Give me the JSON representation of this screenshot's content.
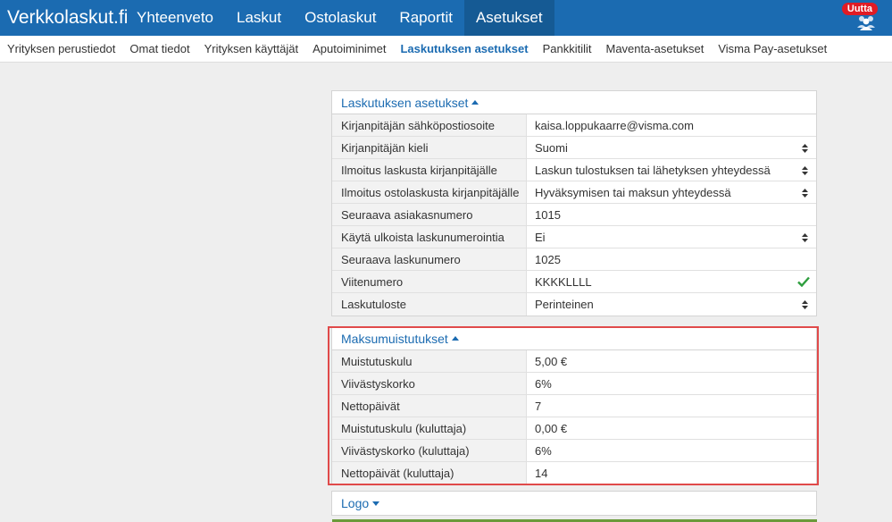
{
  "app": {
    "brand": "Verkkolaskut.fi",
    "nav": [
      "Yhteenveto",
      "Laskut",
      "Ostolaskut",
      "Raportit",
      "Asetukset"
    ],
    "nav_active_index": 4,
    "new_badge": "Uutta",
    "icon": "users-icon"
  },
  "subnav": {
    "items": [
      "Yrityksen perustiedot",
      "Omat tiedot",
      "Yrityksen käyttäjät",
      "Aputoiminimet",
      "Laskutuksen asetukset",
      "Pankkitilit",
      "Maventa-asetukset",
      "Visma Pay-asetukset"
    ],
    "active_index": 4
  },
  "billing": {
    "title": "Laskutuksen asetukset",
    "rows": [
      {
        "label": "Kirjanpitäjän sähköpostiosoite",
        "value": "kaisa.loppukaarre@visma.com",
        "control": "text"
      },
      {
        "label": "Kirjanpitäjän kieli",
        "value": "Suomi",
        "control": "select"
      },
      {
        "label": "Ilmoitus laskusta kirjanpitäjälle",
        "value": "Laskun tulostuksen tai lähetyksen yhteydessä",
        "control": "select"
      },
      {
        "label": "Ilmoitus ostolaskusta kirjanpitäjälle",
        "value": "Hyväksymisen tai maksun yhteydessä",
        "control": "select"
      },
      {
        "label": "Seuraava asiakasnumero",
        "value": "1015",
        "control": "text"
      },
      {
        "label": "Käytä ulkoista laskunumerointia",
        "value": "Ei",
        "control": "select"
      },
      {
        "label": "Seuraava laskunumero",
        "value": "1025",
        "control": "text"
      },
      {
        "label": "Viitenumero",
        "value": "KKKKLLLL",
        "control": "valid"
      },
      {
        "label": "Laskutuloste",
        "value": "Perinteinen",
        "control": "select"
      }
    ]
  },
  "reminders": {
    "title": "Maksumuistutukset",
    "rows": [
      {
        "label": "Muistutuskulu",
        "value": "5,00 €"
      },
      {
        "label": "Viivästyskorko",
        "value": "6%"
      },
      {
        "label": "Nettopäivät",
        "value": "7"
      },
      {
        "label": "Muistutuskulu (kuluttaja)",
        "value": "0,00 €"
      },
      {
        "label": "Viivästyskorko (kuluttaja)",
        "value": "6%"
      },
      {
        "label": "Nettopäivät (kuluttaja)",
        "value": "14"
      }
    ]
  },
  "logo": {
    "title": "Logo"
  },
  "colors": {
    "nav": "#1b6bb1",
    "nav_active": "#155a94",
    "badge": "#e01b24",
    "highlight": "#e04a4a",
    "check": "#2e9e3e"
  }
}
